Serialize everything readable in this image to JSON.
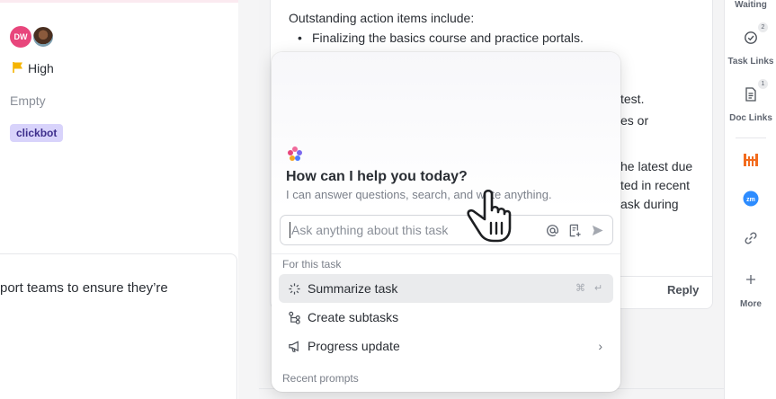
{
  "left_panel": {
    "assignees": [
      {
        "initials": "DW",
        "color": "#e8467c"
      },
      {
        "initials": "",
        "color": "#7d9fb0"
      }
    ],
    "priority": {
      "label": "High",
      "color": "#f5b400"
    },
    "empty_label": "Empty",
    "tag": {
      "label": "clickbot",
      "bg": "#d8d3fb"
    },
    "card_text": "port teams to ensure they’re"
  },
  "document": {
    "line1": "Outstanding action items include:",
    "bullet1": "Finalizing the basics course and practice portals.",
    "frag1": "test.",
    "frag2": "es or",
    "frag3": "he latest due",
    "frag4": "ted in recent",
    "frag5": "ask during",
    "reply_label": "Reply"
  },
  "right_sidebar": {
    "waiting_label": "Waiting",
    "task_links": {
      "label": "Task Links",
      "count": "2"
    },
    "doc_links": {
      "label": "Doc Links",
      "count": "1"
    },
    "more_label": "More",
    "integrations": [
      "harvest-icon",
      "zoom-icon",
      "link-icon"
    ]
  },
  "ai_popup": {
    "title": "How can I help you today?",
    "subtitle": "I can answer questions, search, and write anything.",
    "input_placeholder": "Ask anything about this task",
    "section_for_task": "For this task",
    "items": [
      {
        "label": "Summarize task",
        "icon": "sparkle-icon",
        "shortcut_mod": "⌘",
        "shortcut_key": "↵"
      },
      {
        "label": "Create subtasks",
        "icon": "subtasks-icon"
      },
      {
        "label": "Progress update",
        "icon": "megaphone-icon",
        "has_submenu": true
      }
    ],
    "section_recent": "Recent prompts"
  },
  "colors": {
    "accent": "#7b68ee",
    "zoom": "#2d8cff",
    "harvest": "#f26b1d",
    "priority_flag": "#f5b400"
  }
}
